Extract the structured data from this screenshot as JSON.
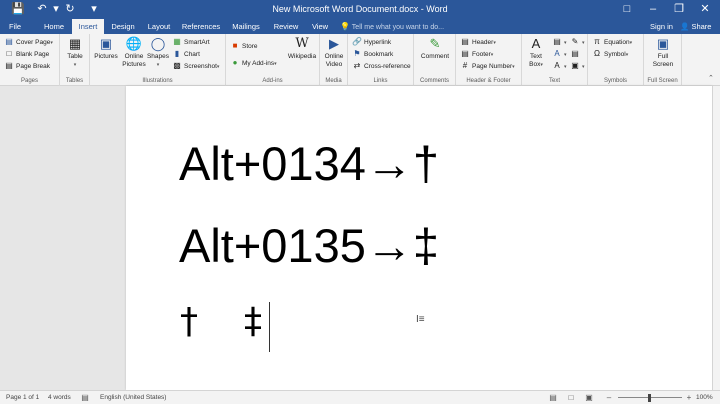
{
  "titlebar": {
    "title": "New Microsoft Word Document.docx - Word",
    "save_icon": "save-icon",
    "undo_icon": "undo-icon",
    "redo_icon": "redo-icon",
    "customize_icon": "customize-icon"
  },
  "tabs": [
    "File",
    "Home",
    "Insert",
    "Design",
    "Layout",
    "References",
    "Mailings",
    "Review",
    "View"
  ],
  "active_tab": "Insert",
  "tell_me": "Tell me what you want to do...",
  "sign_in": "Sign in",
  "share": "Share",
  "ribbon": {
    "pages": {
      "label": "Pages",
      "cover_page": "Cover Page",
      "blank_page": "Blank Page",
      "page_break": "Page Break"
    },
    "tables": {
      "label": "Tables",
      "table": "Table"
    },
    "illustrations": {
      "label": "Illustrations",
      "pictures": "Pictures",
      "online_pictures_1": "Online",
      "online_pictures_2": "Pictures",
      "shapes": "Shapes",
      "smartart": "SmartArt",
      "chart": "Chart",
      "screenshot": "Screenshot"
    },
    "addins": {
      "label": "Add-ins",
      "store": "Store",
      "my_addins": "My Add-ins",
      "wikipedia": "Wikipedia"
    },
    "media": {
      "label": "Media",
      "online_video_1": "Online",
      "online_video_2": "Video"
    },
    "links": {
      "label": "Links",
      "hyperlink": "Hyperlink",
      "bookmark": "Bookmark",
      "cross_reference": "Cross-reference"
    },
    "comments": {
      "label": "Comments",
      "comment": "Comment"
    },
    "header_footer": {
      "label": "Header & Footer",
      "header": "Header",
      "footer": "Footer",
      "page_number": "Page Number"
    },
    "text": {
      "label": "Text",
      "text_box_1": "Text",
      "text_box_2": "Box"
    },
    "symbols": {
      "label": "Symbols",
      "equation": "Equation",
      "symbol": "Symbol"
    },
    "full_screen": {
      "label": "Full Screen",
      "button_1": "Full",
      "button_2": "Screen"
    }
  },
  "document": {
    "line1": "Alt+0134→†",
    "line2": "Alt+0135→‡",
    "glyph1": "†",
    "glyph2": "‡"
  },
  "statusbar": {
    "page": "Page 1 of 1",
    "words": "4 words",
    "language": "English (United States)",
    "zoom": "100%"
  },
  "colors": {
    "accent": "#2b579a",
    "ribbon": "#f3f3f3",
    "canvas": "#e6e6e6"
  }
}
